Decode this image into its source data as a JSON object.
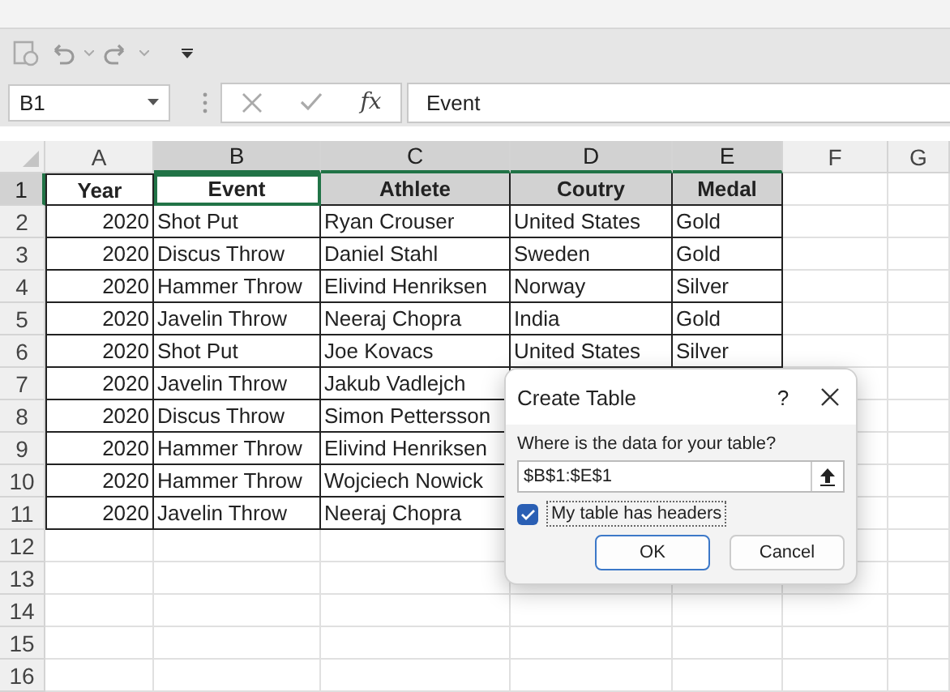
{
  "name_box": {
    "value": "B1"
  },
  "formula_bar": {
    "function_label": "fx",
    "value": "Event"
  },
  "columns": [
    {
      "label": "A",
      "selected": false
    },
    {
      "label": "B",
      "selected": true
    },
    {
      "label": "C",
      "selected": true
    },
    {
      "label": "D",
      "selected": true
    },
    {
      "label": "E",
      "selected": true
    },
    {
      "label": "F",
      "selected": false
    },
    {
      "label": "G",
      "selected": false
    }
  ],
  "rows": [
    {
      "label": "1",
      "selected": true,
      "kind": "header",
      "cells": [
        "Year",
        "Event",
        "Athlete",
        "Coutry",
        "Medal"
      ]
    },
    {
      "label": "2",
      "selected": false,
      "kind": "data",
      "cells": [
        "2020",
        "Shot Put",
        "Ryan Crouser",
        "United States",
        "Gold"
      ]
    },
    {
      "label": "3",
      "selected": false,
      "kind": "data",
      "cells": [
        "2020",
        "Discus Throw",
        "Daniel Stahl",
        "Sweden",
        "Gold"
      ]
    },
    {
      "label": "4",
      "selected": false,
      "kind": "data",
      "cells": [
        "2020",
        "Hammer Throw",
        "Elivind Henriksen",
        "Norway",
        "Silver"
      ]
    },
    {
      "label": "5",
      "selected": false,
      "kind": "data",
      "cells": [
        "2020",
        "Javelin Throw",
        "Neeraj Chopra",
        "India",
        "Gold"
      ]
    },
    {
      "label": "6",
      "selected": false,
      "kind": "data",
      "cells": [
        "2020",
        "Shot Put",
        "Joe Kovacs",
        "United States",
        "Silver"
      ]
    },
    {
      "label": "7",
      "selected": false,
      "kind": "data",
      "cells": [
        "2020",
        "Javelin Throw",
        "Jakub Vadlejch"
      ]
    },
    {
      "label": "8",
      "selected": false,
      "kind": "data",
      "cells": [
        "2020",
        "Discus Throw",
        "Simon Pettersson"
      ]
    },
    {
      "label": "9",
      "selected": false,
      "kind": "data",
      "cells": [
        "2020",
        "Hammer Throw",
        "Elivind Henriksen"
      ]
    },
    {
      "label": "10",
      "selected": false,
      "kind": "data",
      "cells": [
        "2020",
        "Hammer Throw",
        "Wojciech Nowick"
      ]
    },
    {
      "label": "11",
      "selected": false,
      "kind": "data",
      "cells": [
        "2020",
        "Javelin Throw",
        "Neeraj Chopra"
      ]
    },
    {
      "label": "12",
      "selected": false,
      "kind": "empty",
      "cells": []
    },
    {
      "label": "13",
      "selected": false,
      "kind": "empty",
      "cells": []
    },
    {
      "label": "14",
      "selected": false,
      "kind": "empty",
      "cells": []
    },
    {
      "label": "15",
      "selected": false,
      "kind": "empty",
      "cells": []
    },
    {
      "label": "16",
      "selected": false,
      "kind": "empty",
      "cells": []
    }
  ],
  "dialog": {
    "title": "Create Table",
    "help": "?",
    "prompt": "Where is the data for your table?",
    "range": "$B$1:$E$1",
    "headers_checkbox": {
      "label": "My table has headers",
      "checked": true
    },
    "buttons": [
      "OK",
      "Cancel"
    ]
  }
}
